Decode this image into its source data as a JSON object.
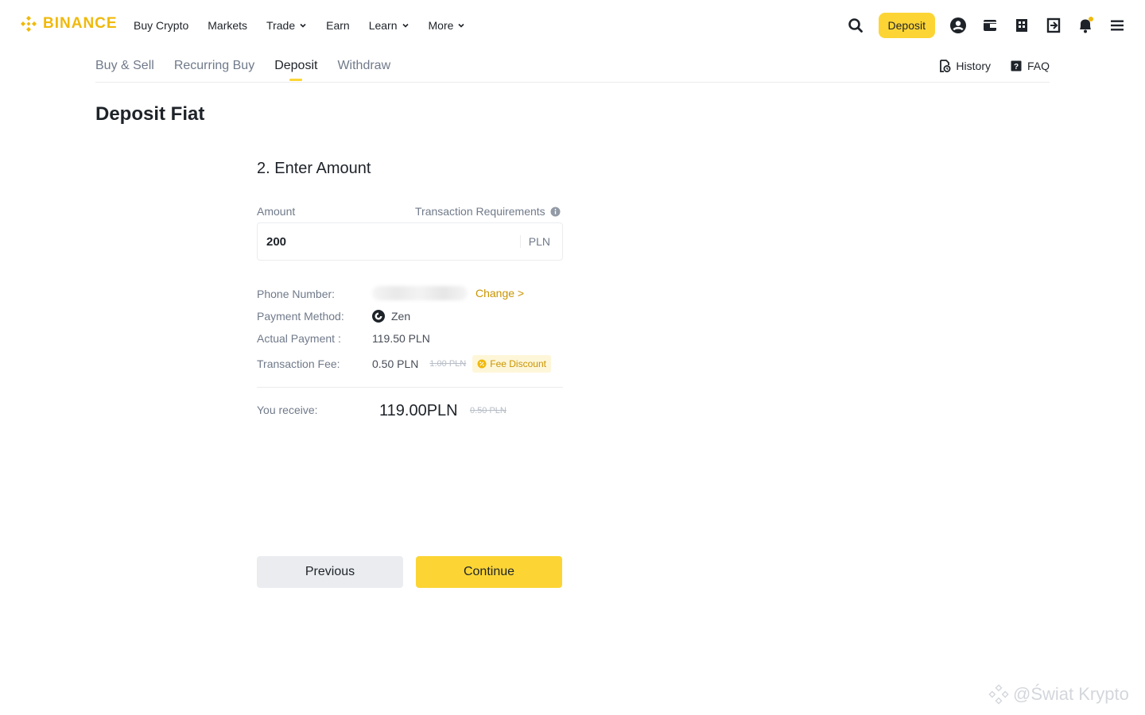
{
  "brand": {
    "name": "BINANCE",
    "accent": "#f0b90b",
    "button_yellow": "#fcd535"
  },
  "nav": {
    "items": [
      {
        "label": "Buy Crypto",
        "has_caret": false
      },
      {
        "label": "Markets",
        "has_caret": false
      },
      {
        "label": "Trade",
        "has_caret": true
      },
      {
        "label": "Earn",
        "has_caret": false
      },
      {
        "label": "Learn",
        "has_caret": true
      },
      {
        "label": "More",
        "has_caret": true
      }
    ],
    "deposit_label": "Deposit",
    "icons": [
      "search-icon",
      "user-icon",
      "wallet-icon",
      "orders-icon",
      "download-icon",
      "bell-icon",
      "menu-icon"
    ]
  },
  "subnav": {
    "tabs": [
      "Buy & Sell",
      "Recurring Buy",
      "Deposit",
      "Withdraw"
    ],
    "active_tab": "Deposit",
    "history_label": "History",
    "faq_label": "FAQ"
  },
  "page": {
    "title": "Deposit Fiat"
  },
  "form": {
    "step_title": "2. Enter Amount",
    "amount_label": "Amount",
    "requirements_label": "Transaction Requirements",
    "amount_value": "200",
    "amount_unit": "PLN",
    "phone_label": "Phone Number:",
    "change_label": "Change >",
    "payment_method_label": "Payment Method:",
    "payment_method_value": "Zen",
    "actual_payment_label": "Actual Payment :",
    "actual_payment_value": "119.50 PLN",
    "fee_label": "Transaction Fee:",
    "fee_value": "0.50 PLN",
    "fee_original": "1.00 PLN",
    "fee_discount_label": "Fee Discount",
    "receive_label": "You receive:",
    "receive_value": "119.00PLN",
    "receive_original": "0.50 PLN",
    "previous_label": "Previous",
    "continue_label": "Continue"
  },
  "watermark": {
    "text": "@Świat Krypto"
  }
}
